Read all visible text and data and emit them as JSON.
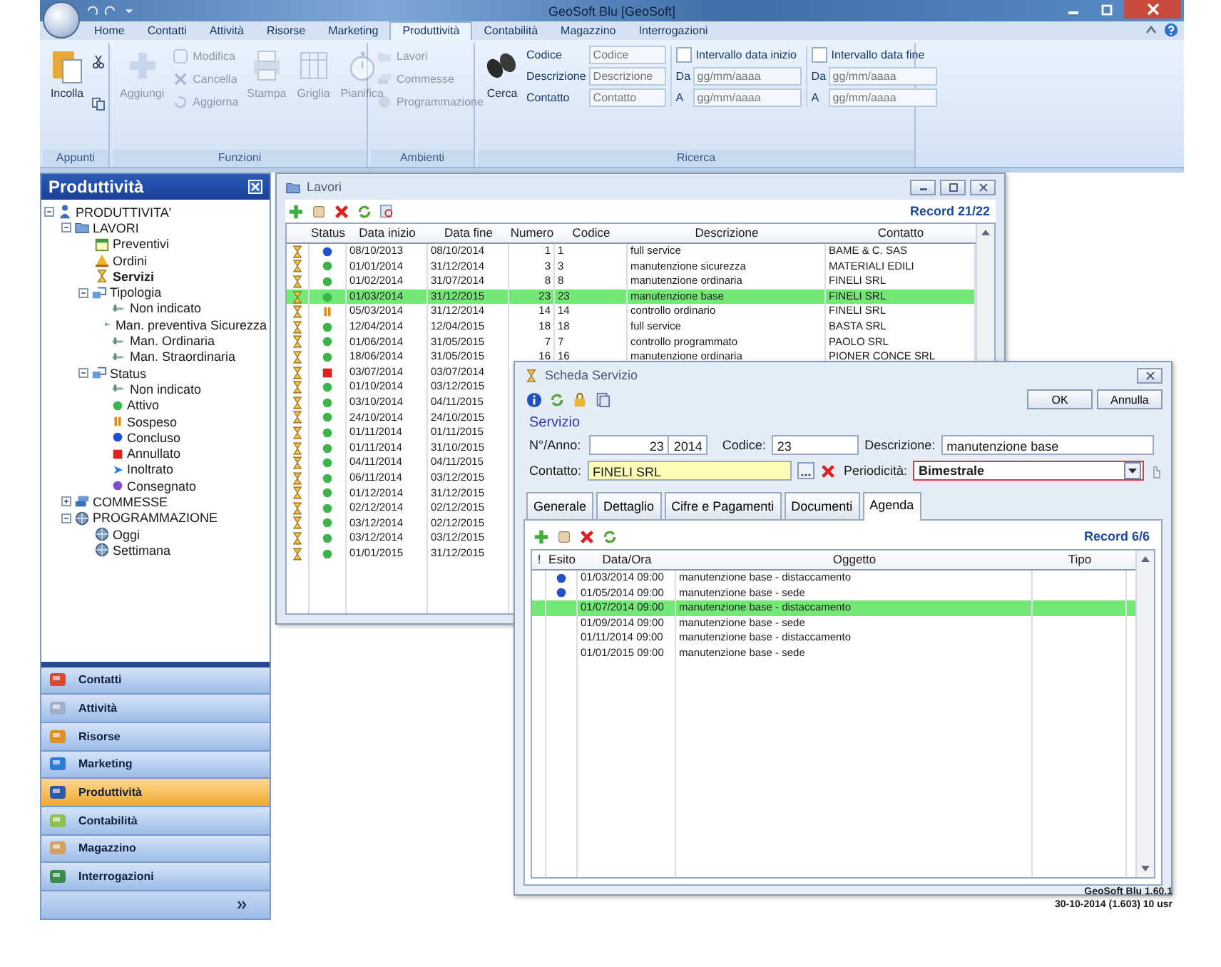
{
  "window": {
    "title": "GeoSoft Blu [GeoSoft]"
  },
  "ribbon_tabs": [
    {
      "label": "Home",
      "selected": false
    },
    {
      "label": "Contatti",
      "selected": false
    },
    {
      "label": "Attività",
      "selected": false
    },
    {
      "label": "Risorse",
      "selected": false
    },
    {
      "label": "Marketing",
      "selected": false
    },
    {
      "label": "Produttività",
      "selected": true
    },
    {
      "label": "Contabilità",
      "selected": false
    },
    {
      "label": "Magazzino",
      "selected": false
    },
    {
      "label": "Interrogazioni",
      "selected": false
    }
  ],
  "ribbon": {
    "appunti": {
      "label": "Appunti",
      "paste": "Incolla"
    },
    "funzioni": {
      "label": "Funzioni",
      "buttons": [
        {
          "kind": "large",
          "label": "Aggiungi",
          "disabled": true
        },
        {
          "kind": "stack",
          "items": [
            {
              "label": "Modifica",
              "disabled": true
            },
            {
              "label": "Cancella",
              "disabled": true
            },
            {
              "label": "Aggiorna",
              "disabled": true
            }
          ]
        },
        {
          "kind": "large",
          "label": "Stampa",
          "disabled": true
        },
        {
          "kind": "large",
          "label": "Griglia",
          "disabled": true
        },
        {
          "kind": "large",
          "label": "Pianifica",
          "disabled": true
        }
      ]
    },
    "ambienti": {
      "label": "Ambienti",
      "items": [
        {
          "label": "Lavori",
          "disabled": true
        },
        {
          "label": "Commesse",
          "disabled": true
        },
        {
          "label": "Programmazione",
          "disabled": true
        }
      ]
    },
    "ricerca": {
      "label": "Ricerca",
      "search_button": "Cerca",
      "fields": [
        {
          "label": "Codice",
          "placeholder": "Codice"
        },
        {
          "label": "Descrizione",
          "placeholder": "Descrizione"
        },
        {
          "label": "Contatto",
          "placeholder": "Contatto"
        }
      ],
      "ranges": [
        {
          "label": "Intervallo data inizio",
          "checked": false,
          "from_label": "Da",
          "from_placeholder": "gg/mm/aaaa",
          "to_label": "A",
          "to_placeholder": "gg/mm/aaaa"
        },
        {
          "label": "Intervallo data fine",
          "checked": false,
          "from_label": "Da",
          "from_placeholder": "gg/mm/aaaa",
          "to_label": "A",
          "to_placeholder": "gg/mm/aaaa"
        }
      ]
    }
  },
  "sidebar": {
    "title": "Produttività",
    "tree": [
      {
        "kind": "root",
        "label": "PRODUTTIVITA'",
        "selected": false,
        "expanded": true,
        "children": [
          {
            "kind": "lavori",
            "label": "LAVORI",
            "selected": false,
            "expanded": true,
            "children": [
              {
                "kind": "preventivi",
                "label": "Preventivi",
                "selected": false
              },
              {
                "kind": "ordini",
                "label": "Ordini",
                "selected": false
              },
              {
                "kind": "servizi",
                "label": "Servizi",
                "selected": true
              },
              {
                "kind": "group",
                "label": "Tipologia",
                "selected": false,
                "expanded": true,
                "children": [
                  {
                    "kind": "leaf",
                    "label": "Non indicato",
                    "selected": false
                  },
                  {
                    "kind": "leaf",
                    "label": "Man. preventiva Sicurezza",
                    "selected": false
                  },
                  {
                    "kind": "leaf",
                    "label": "Man. Ordinaria",
                    "selected": false
                  },
                  {
                    "kind": "leaf",
                    "label": "Man. Straordinaria",
                    "selected": false
                  }
                ]
              },
              {
                "kind": "group",
                "label": "Status",
                "selected": false,
                "expanded": true,
                "children": [
                  {
                    "kind": "leaf",
                    "label": "Non indicato",
                    "selected": false
                  },
                  {
                    "kind": "attivo",
                    "label": "Attivo",
                    "selected": false
                  },
                  {
                    "kind": "sospeso",
                    "label": "Sospeso",
                    "selected": false
                  },
                  {
                    "kind": "concluso",
                    "label": "Concluso",
                    "selected": false
                  },
                  {
                    "kind": "annullato",
                    "label": "Annullato",
                    "selected": false
                  },
                  {
                    "kind": "inoltrato",
                    "label": "Inoltrato",
                    "selected": false
                  },
                  {
                    "kind": "consegnato",
                    "label": "Consegnato",
                    "selected": false
                  }
                ]
              }
            ]
          },
          {
            "kind": "commesse",
            "label": "COMMESSE",
            "selected": false,
            "expanded": false
          },
          {
            "kind": "globe",
            "label": "PROGRAMMAZIONE",
            "selected": false,
            "expanded": true,
            "children": [
              {
                "kind": "globe",
                "label": "Oggi",
                "selected": false
              },
              {
                "kind": "globe",
                "label": "Settimana",
                "selected": false
              }
            ]
          }
        ]
      }
    ],
    "nav": [
      {
        "label": "Contatti",
        "selected": false
      },
      {
        "label": "Attività",
        "selected": false
      },
      {
        "label": "Risorse",
        "selected": false
      },
      {
        "label": "Marketing",
        "selected": false
      },
      {
        "label": "Produttività",
        "selected": true
      },
      {
        "label": "Contabilità",
        "selected": false
      },
      {
        "label": "Magazzino",
        "selected": false
      },
      {
        "label": "Interrogazioni",
        "selected": false
      }
    ]
  },
  "lavori_window": {
    "title": "Lavori",
    "record": "Record 21/22",
    "columns": [
      "Status",
      "Data inizio",
      "Data fine",
      "Numero",
      "Codice",
      "Descrizione",
      "Contatto"
    ],
    "rows": [
      {
        "kind": "concluso",
        "selected": false,
        "data_inizio": "08/10/2013",
        "data_fine": "08/10/2014",
        "numero": "1",
        "codice": "1",
        "descrizione": "full service",
        "contatto": "BAME & C. SAS"
      },
      {
        "kind": "attivo",
        "selected": false,
        "data_inizio": "01/01/2014",
        "data_fine": "31/12/2014",
        "numero": "3",
        "codice": "3",
        "descrizione": "manutenzione sicurezza",
        "contatto": "MATERIALI EDILI"
      },
      {
        "kind": "attivo",
        "selected": false,
        "data_inizio": "01/02/2014",
        "data_fine": "31/07/2014",
        "numero": "8",
        "codice": "8",
        "descrizione": "manutenzione ordinaria",
        "contatto": "FINELI SRL"
      },
      {
        "kind": "attivo",
        "selected": true,
        "data_inizio": "01/03/2014",
        "data_fine": "31/12/2015",
        "numero": "23",
        "codice": "23",
        "descrizione": "manutenzione base",
        "contatto": "FINELI SRL"
      },
      {
        "kind": "sospeso",
        "selected": false,
        "data_inizio": "05/03/2014",
        "data_fine": "31/12/2014",
        "numero": "14",
        "codice": "14",
        "descrizione": "controllo ordinario",
        "contatto": "FINELI SRL"
      },
      {
        "kind": "attivo",
        "selected": false,
        "data_inizio": "12/04/2014",
        "data_fine": "12/04/2015",
        "numero": "18",
        "codice": "18",
        "descrizione": "full service",
        "contatto": "BASTA SRL"
      },
      {
        "kind": "attivo",
        "selected": false,
        "data_inizio": "01/06/2014",
        "data_fine": "31/05/2015",
        "numero": "7",
        "codice": "7",
        "descrizione": "controllo programmato",
        "contatto": "PAOLO SRL"
      },
      {
        "kind": "attivo",
        "selected": false,
        "data_inizio": "18/06/2014",
        "data_fine": "31/05/2015",
        "numero": "16",
        "codice": "16",
        "descrizione": "manutenzione ordinaria",
        "contatto": "PIONER CONCE SRL"
      },
      {
        "kind": "annullato",
        "selected": false,
        "data_inizio": "03/07/2014",
        "data_fine": "03/07/2014"
      },
      {
        "kind": "attivo",
        "selected": false,
        "data_inizio": "01/10/2014",
        "data_fine": "03/12/2015"
      },
      {
        "kind": "attivo",
        "selected": false,
        "data_inizio": "03/10/2014",
        "data_fine": "04/11/2015"
      },
      {
        "kind": "attivo",
        "selected": false,
        "data_inizio": "24/10/2014",
        "data_fine": "24/10/2015"
      },
      {
        "kind": "attivo",
        "selected": false,
        "data_inizio": "01/11/2014",
        "data_fine": "01/11/2015"
      },
      {
        "kind": "attivo",
        "selected": false,
        "data_inizio": "01/11/2014",
        "data_fine": "31/10/2015"
      },
      {
        "kind": "attivo",
        "selected": false,
        "data_inizio": "04/11/2014",
        "data_fine": "04/11/2015"
      },
      {
        "kind": "attivo",
        "selected": false,
        "data_inizio": "06/11/2014",
        "data_fine": "03/12/2015"
      },
      {
        "kind": "attivo",
        "selected": false,
        "data_inizio": "01/12/2014",
        "data_fine": "31/12/2015"
      },
      {
        "kind": "attivo",
        "selected": false,
        "data_inizio": "02/12/2014",
        "data_fine": "02/12/2015"
      },
      {
        "kind": "attivo",
        "selected": false,
        "data_inizio": "03/12/2014",
        "data_fine": "02/12/2015"
      },
      {
        "kind": "attivo",
        "selected": false,
        "data_inizio": "03/12/2014",
        "data_fine": "03/12/2015"
      },
      {
        "kind": "attivo",
        "selected": false,
        "data_inizio": "01/01/2015",
        "data_fine": "31/12/2015"
      }
    ]
  },
  "scheda_window": {
    "title": "Scheda Servizio",
    "buttons": [
      "OK",
      "Annulla"
    ],
    "section": "Servizio",
    "numero_label": "N°/Anno:",
    "numero": "23",
    "anno": "2014",
    "codice_label": "Codice:",
    "codice": "23",
    "descrizione_label": "Descrizione:",
    "descrizione": "manutenzione base",
    "contatto_label": "Contatto:",
    "contatto": "FINELI SRL",
    "periodicita_label": "Periodicità:",
    "periodicita": "Bimestrale",
    "tabs": [
      {
        "label": "Generale",
        "selected": false
      },
      {
        "label": "Dettaglio",
        "selected": false
      },
      {
        "label": "Cifre e Pagamenti",
        "selected": false
      },
      {
        "label": "Documenti",
        "selected": false
      },
      {
        "label": "Agenda",
        "selected": true
      }
    ],
    "record": "Record 6/6",
    "columns": [
      "!",
      "Esito",
      "Data/Ora",
      "Oggetto",
      "Tipo"
    ],
    "rows": [
      {
        "kind": "concluso",
        "selected": false,
        "data_ora": "01/03/2014 09:00",
        "oggetto": "manutenzione base - distaccamento"
      },
      {
        "kind": "concluso",
        "selected": false,
        "data_ora": "01/05/2014 09:00",
        "oggetto": "manutenzione base - sede"
      },
      {
        "kind": "none",
        "selected": true,
        "data_ora": "01/07/2014 09:00",
        "oggetto": "manutenzione base - distaccamento"
      },
      {
        "kind": "none",
        "selected": false,
        "data_ora": "01/09/2014 09:00",
        "oggetto": "manutenzione base - sede"
      },
      {
        "kind": "none",
        "selected": false,
        "data_ora": "01/11/2014 09:00",
        "oggetto": "manutenzione base - distaccamento"
      },
      {
        "kind": "none",
        "selected": false,
        "data_ora": "01/01/2015 09:00",
        "oggetto": "manutenzione base - sede"
      }
    ]
  },
  "status_bar": {
    "version": "GeoSoft Blu 1.60.1",
    "build": "30-10-2014 (1.603) 10 usr"
  }
}
